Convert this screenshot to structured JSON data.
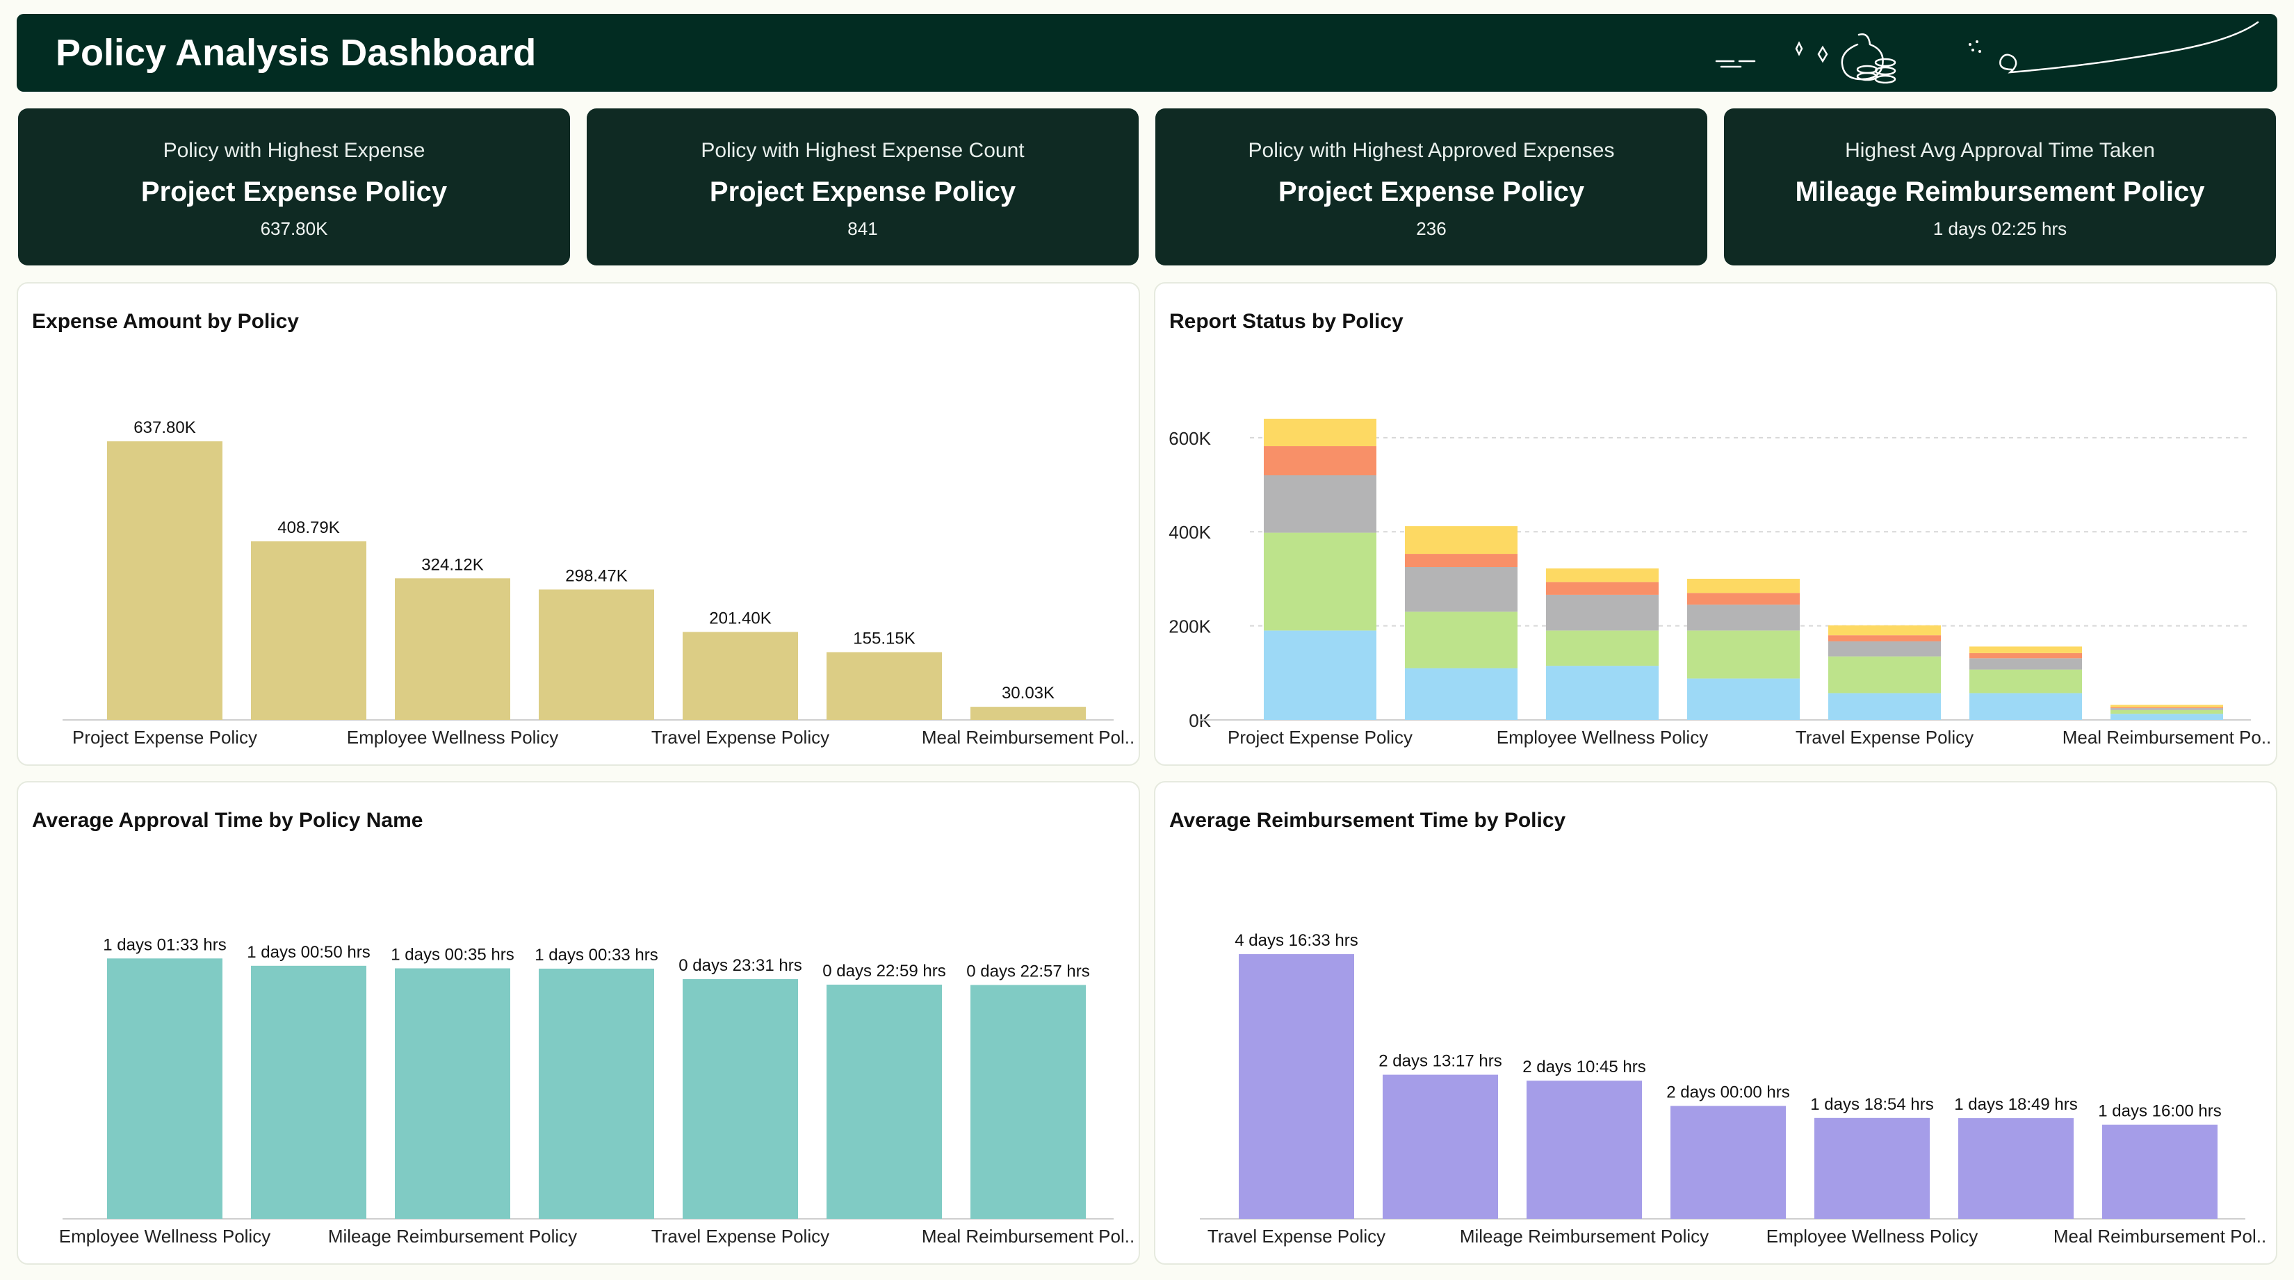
{
  "header": {
    "title": "Policy Analysis Dashboard"
  },
  "kpis": [
    {
      "label": "Policy with Highest Expense",
      "value": "Project Expense Policy",
      "sub": "637.80K"
    },
    {
      "label": "Policy with Highest Expense Count",
      "value": "Project Expense Policy",
      "sub": "841"
    },
    {
      "label": "Policy with Highest Approved Expenses",
      "value": "Project Expense Policy",
      "sub": "236"
    },
    {
      "label": "Highest Avg Approval Time Taken",
      "value": "Mileage Reimbursement Policy",
      "sub": "1 days 02:25 hrs"
    }
  ],
  "panels": {
    "expense": {
      "title": "Expense Amount by Policy"
    },
    "status": {
      "title": "Report Status by Policy"
    },
    "approval": {
      "title": "Average Approval Time by Policy Name"
    },
    "reimb": {
      "title": "Average Reimbursement Time by Policy"
    }
  },
  "chart_data": [
    {
      "id": "expense",
      "type": "bar",
      "title": "Expense Amount by Policy",
      "categories": [
        "Project Expense Policy",
        "",
        "Employee Wellness Policy",
        "",
        "Travel Expense Policy",
        "",
        "Meal Reimbursement Pol.."
      ],
      "values": [
        637.8,
        408.79,
        324.12,
        298.47,
        201.4,
        155.15,
        30.03
      ],
      "data_labels": [
        "637.80K",
        "408.79K",
        "324.12K",
        "298.47K",
        "201.40K",
        "155.15K",
        "30.03K"
      ],
      "color": "#dccd85",
      "ylim": [
        0,
        700
      ]
    },
    {
      "id": "status",
      "type": "bar",
      "title": "Report Status by Policy",
      "stacked": true,
      "categories": [
        "Project Expense Policy",
        "",
        "Employee Wellness Policy",
        "",
        "Travel Expense Policy",
        "",
        "Meal Reimbursement Po.."
      ],
      "yticks": [
        "0K",
        "200K",
        "400K",
        "600K"
      ],
      "ylim": [
        0,
        650
      ],
      "grid": true,
      "series": [
        {
          "values": [
            190,
            110,
            115,
            88,
            57,
            57,
            13
          ],
          "color": "#9dd9f6"
        },
        {
          "values": [
            208,
            120,
            75,
            102,
            78,
            50,
            8
          ],
          "color": "#bde38b"
        },
        {
          "values": [
            122,
            95,
            76,
            55,
            32,
            24,
            4
          ],
          "color": "#b4b4b5"
        },
        {
          "values": [
            62,
            28,
            27,
            25,
            13,
            11,
            2
          ],
          "color": "#f89068"
        },
        {
          "values": [
            58,
            59,
            29,
            30,
            21,
            14,
            5
          ],
          "color": "#fdd963"
        }
      ]
    },
    {
      "id": "approval",
      "type": "bar",
      "title": "Average Approval Time by Policy Name",
      "categories": [
        "Employee Wellness Policy",
        "",
        "Mileage Reimbursement Policy",
        "",
        "Travel Expense Policy",
        "",
        "Meal Reimbursement Pol.."
      ],
      "values": [
        25.55,
        24.83,
        24.58,
        24.55,
        23.52,
        22.98,
        22.95
      ],
      "data_labels": [
        "1 days 01:33 hrs",
        "1 days 00:50 hrs",
        "1 days 00:35 hrs",
        "1 days 00:33 hrs",
        "0 days 23:31 hrs",
        "0 days 22:59 hrs",
        "0 days 22:57 hrs"
      ],
      "color": "#80cbc4",
      "ylim": [
        0,
        30
      ]
    },
    {
      "id": "reimb",
      "type": "bar",
      "title": "Average Reimbursement Time by Policy",
      "categories": [
        "Travel Expense Policy",
        "",
        "Mileage Reimbursement Policy",
        "",
        "Employee Wellness Policy",
        "",
        "Meal Reimbursement Pol.."
      ],
      "values": [
        112.55,
        61.28,
        58.75,
        48.0,
        42.9,
        42.82,
        40.0
      ],
      "data_labels": [
        "4 days 16:33 hrs",
        "2 days 13:17 hrs",
        "2 days 10:45 hrs",
        "2 days 00:00 hrs",
        "1 days 18:54 hrs",
        "1 days 18:49 hrs",
        "1 days 16:00 hrs"
      ],
      "color": "#a59de8",
      "ylim": [
        0,
        130
      ]
    }
  ]
}
